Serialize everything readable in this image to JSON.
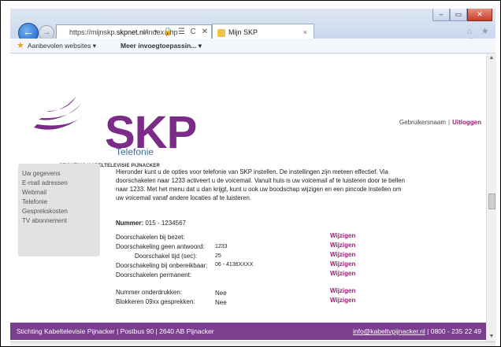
{
  "browser": {
    "url_prefix": "https://mijnskp.",
    "url_domain": "skpnet.nl",
    "url_path": "/index.php",
    "address_icons": "⌕ ▾ 🔒 ☰ C ✕",
    "tab_title": "Mijn SKP",
    "tab_close": "×",
    "window_controls": [
      "–",
      "▭",
      "✕"
    ],
    "toolbar_icons": "⌂ ★ ⚙"
  },
  "favorites": {
    "item1": "Aanbevolen websites ▾",
    "item2": "Meer invoegtoepassin... ▾"
  },
  "brand": {
    "logo_text": "SKP",
    "tagline": "STICHTING KABELTELEVISIE PIJNACKER",
    "accent": "#7a2c87",
    "link": "#a3187a"
  },
  "user": {
    "username_label": "Gebruikersnaam",
    "separator": "|",
    "logout": "Uitloggen"
  },
  "sidebar": {
    "items": [
      {
        "label": "Uw gegevens"
      },
      {
        "label": "E-mail adressen"
      },
      {
        "label": "Webmail"
      },
      {
        "label": "Telefonie"
      },
      {
        "label": "Gesprekskosten"
      },
      {
        "label": "TV abonnement"
      }
    ]
  },
  "main": {
    "title": "Telefonie",
    "intro": "Hieronder kunt u de opties voor telefonie van SKP instellen. De instellingen zijn meteen effectief. Via doorschakelen naar 1233 activeert u de voicemail. Vanuit huis is uw voicemail af te luisteren door te bellen naar 1233. Met het menu dat u dan krijgt, kunt u ook uw boodschap wijzigen en een pincode instellen om uw voicemail vanaf andere locaties af te luisteren.",
    "number_label": "Nummer:",
    "number_value": "015 - 1234567",
    "settings": [
      {
        "label": "Doorschakelen bij bezet:",
        "value": "",
        "action": "Wijzigen"
      },
      {
        "label": "Doorschakeling geen antwoord:",
        "value": "1233",
        "action": "Wijzigen"
      },
      {
        "label": "Doorschakel tijd (sec):",
        "value": "25",
        "action": "Wijzigen"
      },
      {
        "label": "Doorschakeling bij onbereikbaar:",
        "value": "06 - 4136XXXX",
        "action": "Wijzigen"
      },
      {
        "label": "Doorschakelen permanent:",
        "value": "",
        "action": "Wijzigen"
      },
      {
        "label": "Nummer onderdrukken:",
        "value": "Nee",
        "action": "Wijzigen"
      },
      {
        "label": "Blokkeren 09xx gesprekken:",
        "value": "Nee",
        "action": "Wijzigen"
      }
    ]
  },
  "footer": {
    "left": "Stichting Kabeltelevisie Pijnacker | Postbus 90 | 2640 AB Pijnacker",
    "email": "info@kabeltvpijnacker.nl",
    "phone": "| 0800 - 235 22 49"
  }
}
